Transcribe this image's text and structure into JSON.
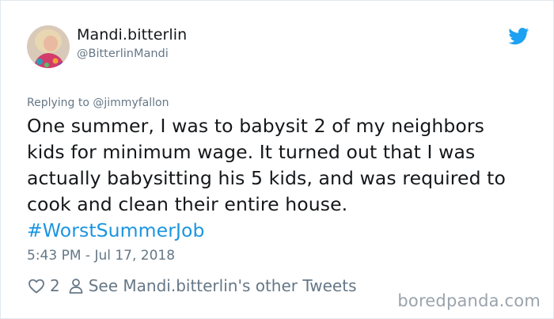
{
  "user": {
    "display_name": "Mandi.bitterlin",
    "handle": "@BitterlinMandi"
  },
  "reply": {
    "prefix": "Replying to",
    "to_handle": "@jimmyfallon"
  },
  "tweet": {
    "lines": [
      "One summer, I was to babysit 2 of my neighbors",
      "kids for minimum wage.  It turned out that I was",
      "actually babysitting his 5 kids, and was required to",
      "cook and clean their entire house."
    ],
    "hashtag": "#WorstSummerJob",
    "timestamp": "5:43 PM - Jul 17, 2018"
  },
  "actions": {
    "like_count": "2",
    "other_tweets_label": "See Mandi.bitterlin's other Tweets"
  },
  "watermark": "boredpanda.com",
  "icons": {
    "brand": "twitter-bird-icon",
    "like": "heart-icon",
    "profile": "person-icon"
  },
  "colors": {
    "twitter_blue": "#1da1f2",
    "link_blue": "#1b95e0",
    "text": "#14171a",
    "muted": "#657786"
  }
}
